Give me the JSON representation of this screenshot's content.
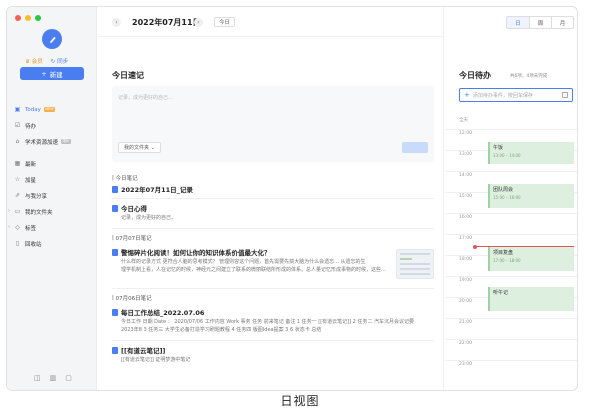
{
  "sidebar": {
    "window_controls": [
      "#ff5f57",
      "#febc2e",
      "#28c840"
    ],
    "vip_label": "会员",
    "sync_label": "同步",
    "new_button": "新建",
    "items": [
      {
        "label": "Today",
        "icon": "calendar-icon",
        "badge": "NEW",
        "active": true
      },
      {
        "label": "待办",
        "icon": "checklist-icon"
      },
      {
        "label": "学术资源加速",
        "icon": "graduation-cap-icon",
        "badge": "限时"
      },
      {
        "label": "最新",
        "icon": "grid-icon"
      },
      {
        "label": "加星",
        "icon": "star-icon"
      },
      {
        "label": "与我分享",
        "icon": "share-icon"
      },
      {
        "label": "我的文件夹",
        "icon": "folder-icon",
        "expandable": true
      },
      {
        "label": "标签",
        "icon": "tag-icon",
        "expandable": true
      },
      {
        "label": "回收站",
        "icon": "trash-icon"
      }
    ]
  },
  "header": {
    "date": "2022年07月11日",
    "today_button": "今日",
    "view_tabs": [
      "日",
      "周",
      "月"
    ]
  },
  "notes_panel": {
    "title": "今日速记",
    "placeholder": "记录，成为更好的自己...",
    "folder_select": "我的文件夹",
    "groups": [
      {
        "heading": "今日笔记",
        "notes": [
          {
            "title": "2022年07月11日_记录",
            "body": []
          },
          {
            "title": "今日心得",
            "body": [
              "记录，成为更好的自己。"
            ]
          }
        ]
      },
      {
        "heading": "07月07日笔记",
        "notes": [
          {
            "title": "警惕碎片化阅读！如何让你的知识体系价值最大化？",
            "body": [
              "什么样的记录方式 更符合人脑的思考模式？ 管理则容这个问题，首先需要先搞大脑为什么会遗忘... 从遗忘的生",
              "理学机制上看，人在记忆的时候，神经元之间建立了联系的微丽联结所形成的体系。总人量记忆形成事物的时候，这些..."
            ],
            "has_thumb": true
          }
        ]
      },
      {
        "heading": "07月06日笔记",
        "notes": [
          {
            "title": "每日工作总结_2022.07.06",
            "body": [
              "今日工作 日期 Date ： 2020/07/06 工作内容 Work 事务 任务 前来笔记 备注 1 任务一 [[有道云笔记]] 2 任务二 汽车沉月会议记要",
              "2023年8 3 任务三 大学生必备打造学习刷题教程 4 任务四 版图Idea提案 3 6 状态卡 总结"
            ]
          },
          {
            "title": "[[有道云笔记]]",
            "body": [
              "[[有道云笔记]] 证明梦游中笔记"
            ]
          }
        ]
      }
    ]
  },
  "todo_panel": {
    "title": "今日待办",
    "subtitle": "共6项，4项未完成",
    "input_placeholder": "添加待办事件，按回车保存",
    "allday_label": "全天",
    "hours": [
      "12:00",
      "13:00",
      "14:00",
      "15:00",
      "16:00",
      "17:00",
      "18:00",
      "19:00",
      "20:00",
      "21:00",
      "22:00",
      "23:00"
    ],
    "events": [
      {
        "title": "午饭",
        "time": "13:00 – 14:00"
      },
      {
        "title": "团队周会",
        "time": "15:00 – 16:00"
      },
      {
        "title": "项目复盘",
        "time": "17:00 – 18:00"
      },
      {
        "title": "听午记",
        "time": ""
      }
    ]
  },
  "caption": "日视图"
}
